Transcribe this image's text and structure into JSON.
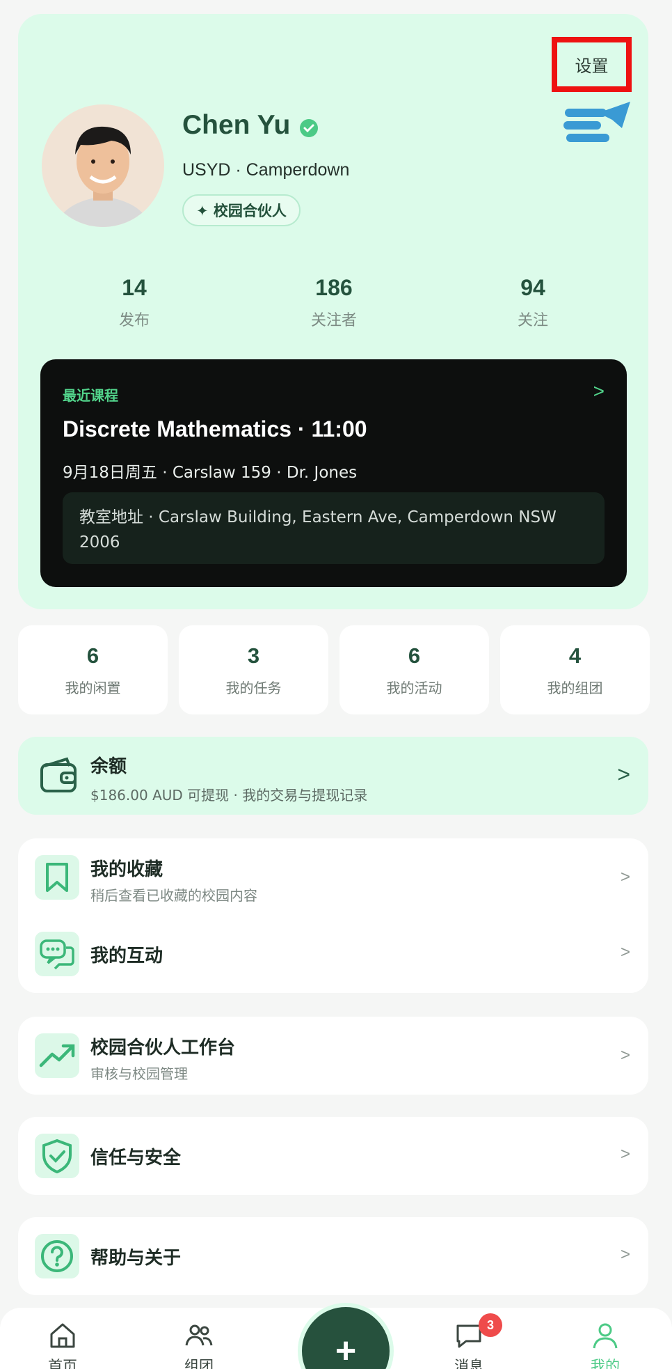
{
  "header": {
    "settings_label": "设置",
    "logo_icon": "brand-logo-icon"
  },
  "profile": {
    "name": "Chen Yu",
    "school": "USYD · Camperdown",
    "badge": "✦ 校园合伙人",
    "verified_icon": "verified-check-icon"
  },
  "stats": [
    {
      "value": "14",
      "label": "发布"
    },
    {
      "value": "186",
      "label": "关注者"
    },
    {
      "value": "94",
      "label": "关注"
    }
  ],
  "course": {
    "tag": "最近课程",
    "chevron": ">",
    "title": "Discrete Mathematics · 11:00",
    "meta": "9月18日周五 · Carslaw 159 · Dr. Jones",
    "address": "教室地址 · Carslaw Building, Eastern Ave, Camperdown NSW 2006"
  },
  "quick": [
    {
      "value": "6",
      "label": "我的闲置"
    },
    {
      "value": "3",
      "label": "我的任务"
    },
    {
      "value": "6",
      "label": "我的活动"
    },
    {
      "value": "4",
      "label": "我的组团"
    }
  ],
  "balance": {
    "title": "余额",
    "subtitle": "$186.00 AUD 可提现 · 我的交易与提现记录",
    "chevron": ">"
  },
  "menu": {
    "favorites_title": "我的收藏",
    "favorites_sub": "稍后查看已收藏的校园内容",
    "interactions_title": "我的互动",
    "partner_title": "校园合伙人工作台",
    "partner_sub": "审核与校园管理",
    "trust_title": "信任与安全",
    "help_title": "帮助与关于",
    "chevron": ">"
  },
  "nav": {
    "home": "首页",
    "groups": "组团",
    "add": "+",
    "messages": "消息",
    "messages_badge": "3",
    "me": "我的"
  },
  "colors": {
    "accent": "#4cca86",
    "brand_dark": "#26513d",
    "card_mint": "#dcfbea",
    "highlight_red": "#ee1111"
  }
}
